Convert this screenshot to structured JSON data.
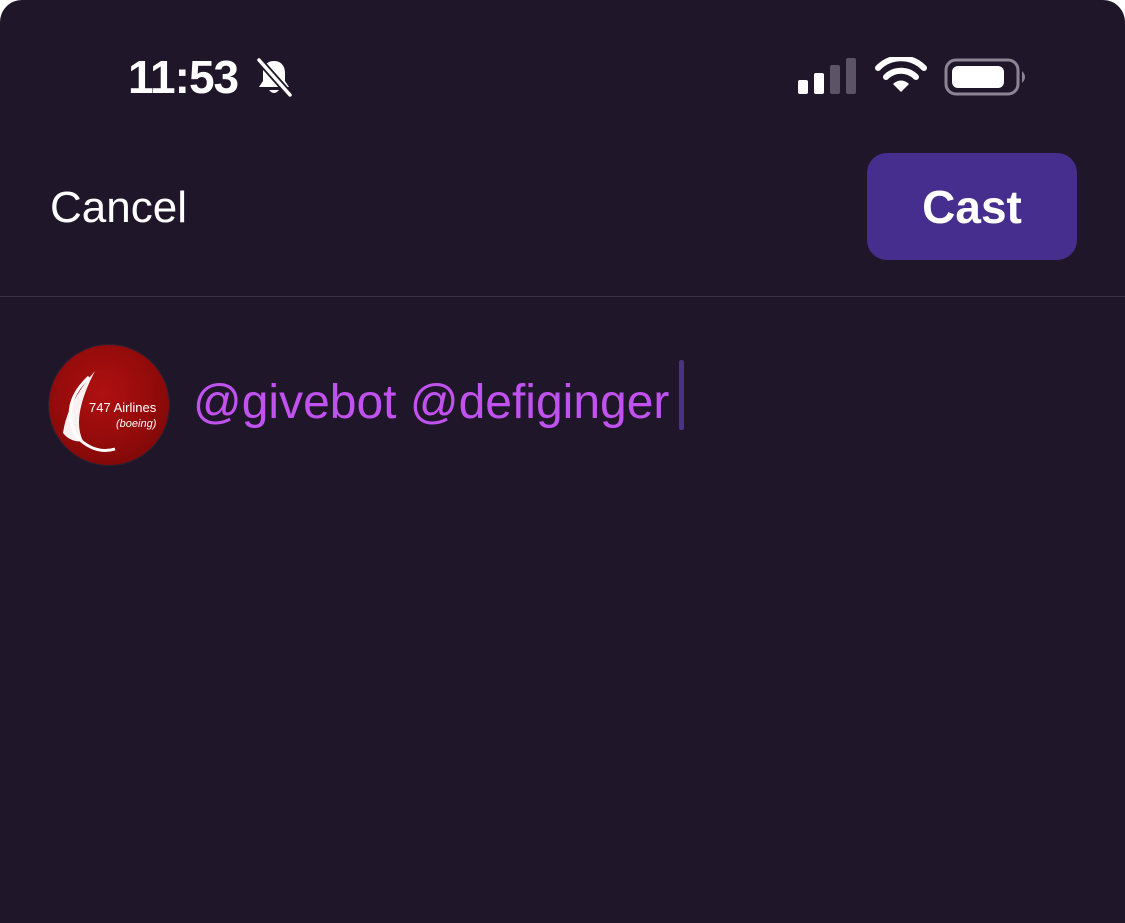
{
  "status_bar": {
    "time": "11:53",
    "icons": [
      "bell-slash-icon",
      "cellular-signal-icon",
      "wifi-icon",
      "battery-icon"
    ]
  },
  "header": {
    "cancel_label": "Cancel",
    "cast_label": "Cast"
  },
  "compose": {
    "text": "@givebot @defiginger",
    "avatar": {
      "line1": "747 Airlines",
      "line2": "(boeing)"
    }
  },
  "colors": {
    "background": "#1f1729",
    "accent_button": "#452e8e",
    "mention_text": "#c152f0",
    "text": "#ffffff"
  }
}
